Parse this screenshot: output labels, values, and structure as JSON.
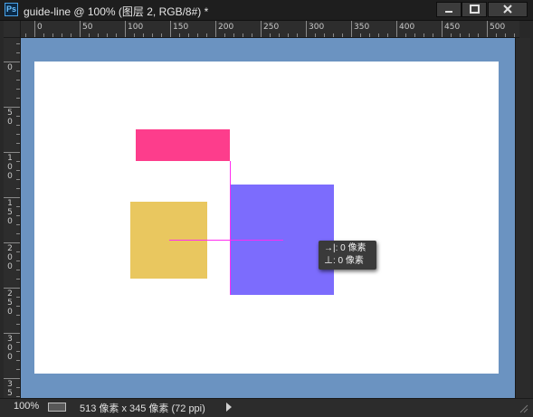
{
  "window": {
    "title": "guide-line @ 100% (图层 2, RGB/8#) *",
    "app_icon": "Ps"
  },
  "ruler": {
    "h_labels": [
      "0",
      "50",
      "100",
      "150",
      "200",
      "250",
      "300",
      "350",
      "400",
      "450",
      "500"
    ],
    "v_labels": [
      "0",
      "50",
      "100",
      "150",
      "200",
      "250",
      "300",
      "350"
    ]
  },
  "tooltip": {
    "row1": "→|: 0 像素",
    "row2": "⊥: 0 像素"
  },
  "status": {
    "zoom": "100%",
    "doc_info": "513 像素 x 345 像素 (72 ppi)"
  },
  "colors": {
    "pasteboard": "#6b93c1",
    "pink": "#fd3d8c",
    "yellow": "#e9c75f",
    "purple": "#7c6cfd",
    "guide": "#ff2df0"
  },
  "icons": {
    "minimize": "minimize-icon",
    "maximize": "maximize-icon",
    "close": "close-icon",
    "doc_status": "document-status-icon",
    "menu_arrow": "play-arrow-icon",
    "resize": "resize-grip-icon"
  }
}
